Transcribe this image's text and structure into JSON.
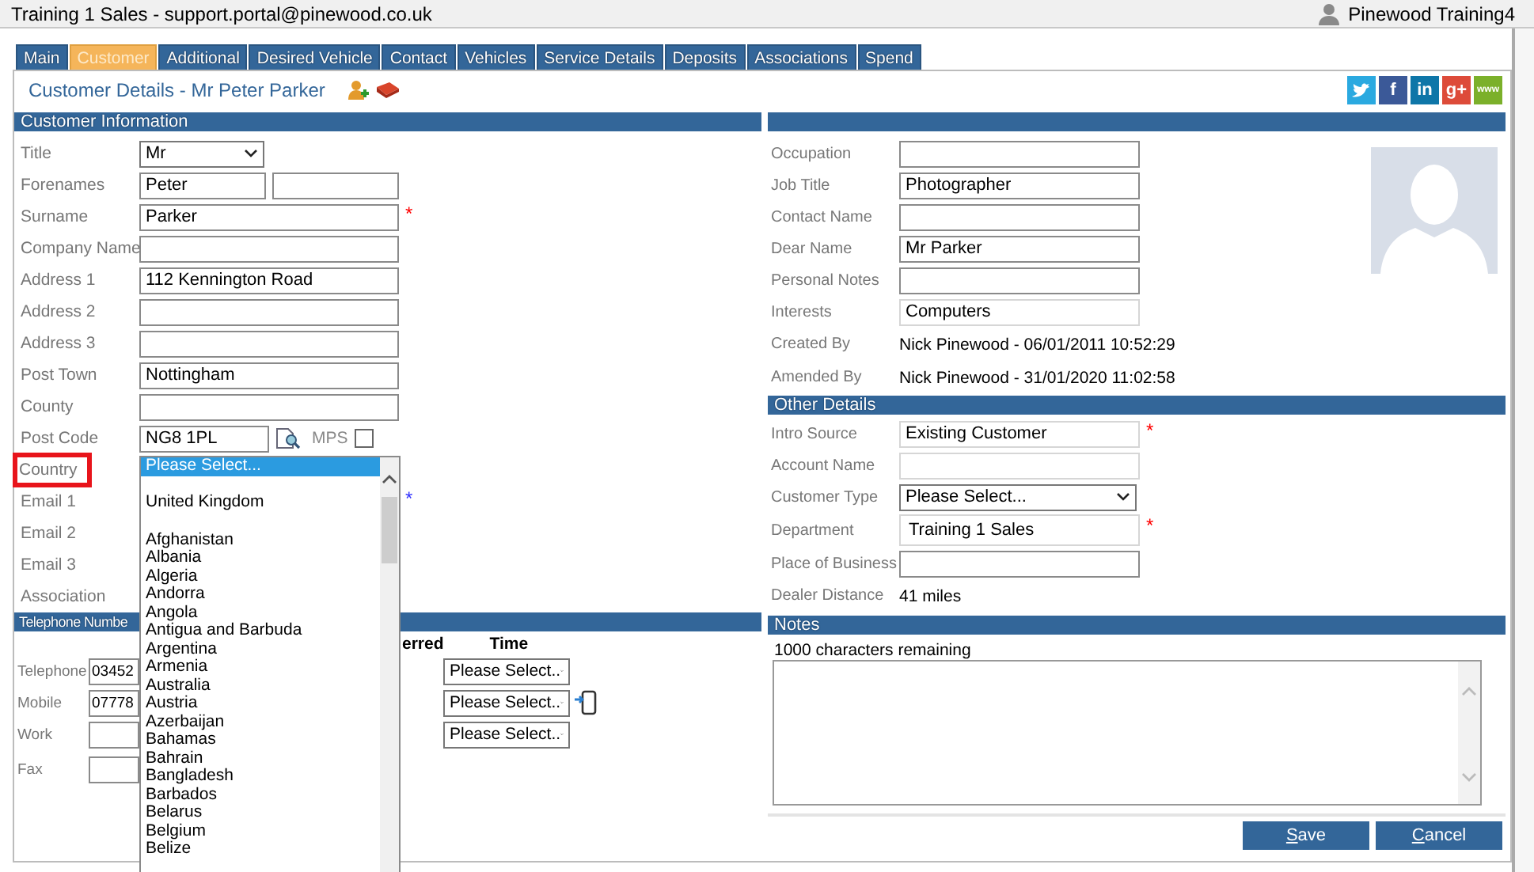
{
  "window": {
    "title": "Training 1 Sales - support.portal@pinewood.co.uk",
    "user": "Pinewood Training4"
  },
  "tabs": [
    {
      "label": "Main",
      "selected": false
    },
    {
      "label": "Customer",
      "selected": true
    },
    {
      "label": "Additional",
      "selected": false
    },
    {
      "label": "Desired Vehicle",
      "selected": false
    },
    {
      "label": "Contact",
      "selected": false
    },
    {
      "label": "Vehicles",
      "selected": false
    },
    {
      "label": "Service Details",
      "selected": false
    },
    {
      "label": "Deposits",
      "selected": false
    },
    {
      "label": "Associations",
      "selected": false
    },
    {
      "label": "Spend",
      "selected": false
    }
  ],
  "page_title": "Customer Details - Mr Peter Parker",
  "social_links": [
    {
      "kind": "twitter"
    },
    {
      "kind": "facebook",
      "glyph": "f"
    },
    {
      "kind": "linkedin",
      "glyph": "in"
    },
    {
      "kind": "google",
      "glyph": "g+"
    },
    {
      "kind": "web",
      "glyph": "www"
    }
  ],
  "customer_information": {
    "heading": "Customer Information",
    "fields": [
      {
        "label": "Title",
        "kind": "select",
        "value": "Mr",
        "highlighted": false
      },
      {
        "label": "Forenames",
        "kind": "pair",
        "value": "Peter",
        "highlighted": false
      },
      {
        "label": "Surname",
        "kind": "text",
        "value": "Parker",
        "required_mark": "*",
        "color": "#ff0000",
        "highlighted": false
      },
      {
        "label": "Company Name",
        "kind": "text",
        "highlighted": false
      },
      {
        "label": "Address 1",
        "kind": "text",
        "value": "112 Kennington Road",
        "highlighted": false
      },
      {
        "label": "Address 2",
        "kind": "text",
        "highlighted": false
      },
      {
        "label": "Address 3",
        "kind": "text",
        "highlighted": false
      },
      {
        "label": "Post Town",
        "kind": "text",
        "value": "Nottingham",
        "highlighted": false
      },
      {
        "label": "County",
        "kind": "text",
        "highlighted": false
      },
      {
        "label": "Post Code",
        "kind": "postcode",
        "value": "NG8 1PL",
        "mps_label": "MPS",
        "mps_checked": false,
        "highlighted": false
      },
      {
        "label": "Country",
        "kind": "covered",
        "highlighted": true
      },
      {
        "label": "Email 1",
        "kind": "covered",
        "required_mark": "*",
        "color": "#3333ff",
        "highlighted": false
      },
      {
        "label": "Email 2",
        "kind": "covered",
        "highlighted": false
      },
      {
        "label": "Email 3",
        "kind": "covered",
        "highlighted": false
      },
      {
        "label": "Association",
        "kind": "covered",
        "highlighted": false
      }
    ]
  },
  "telephone_numbers": {
    "heading": "Telephone Numbe",
    "columns": [
      "erred",
      "Time"
    ],
    "rows": [
      {
        "label": "Telephone",
        "value": "03452",
        "time": "Please Select..",
        "kind": "plain"
      },
      {
        "label": "Mobile",
        "value": "07778",
        "time": "Please Select..",
        "kind": "mobile"
      },
      {
        "label": "Work",
        "time": "Please Select..",
        "kind": "plain"
      },
      {
        "label": "Fax",
        "kind": "plain"
      }
    ]
  },
  "personal_details": {
    "fields": [
      {
        "label": "Occupation",
        "kind": "text"
      },
      {
        "label": "Job Title",
        "kind": "text",
        "value": "Photographer"
      },
      {
        "label": "Contact Name",
        "kind": "text"
      },
      {
        "label": "Dear Name",
        "kind": "text",
        "value": "Mr Parker"
      },
      {
        "label": "Personal Notes",
        "kind": "text"
      },
      {
        "label": "Interests",
        "kind": "light",
        "value": "Computers"
      },
      {
        "label": "Created By",
        "kind": "static",
        "value": "Nick Pinewood - 06/01/2011 10:52:29"
      },
      {
        "label": "Amended By",
        "kind": "static",
        "value": "Nick Pinewood - 31/01/2020 11:02:58"
      }
    ]
  },
  "other_details": {
    "heading": "Other Details",
    "fields": [
      {
        "label": "Intro Source",
        "kind": "light",
        "value": "Existing Customer",
        "required_mark": "*",
        "color": "#ff0000"
      },
      {
        "label": "Account Name",
        "kind": "light"
      },
      {
        "label": "Customer Type",
        "kind": "select",
        "value": "Please Select..."
      },
      {
        "label": "Department",
        "kind": "tall",
        "value": "Training 1 Sales",
        "required_mark": "*",
        "color": "#ff0000"
      },
      {
        "label": "Place of Business",
        "kind": "text"
      },
      {
        "label": "Dealer Distance",
        "kind": "static",
        "value": "41 miles"
      }
    ]
  },
  "notes": {
    "heading": "Notes",
    "counter": "1000 characters remaining"
  },
  "buttons": [
    {
      "label": "Save"
    },
    {
      "label": "Cancel"
    }
  ],
  "country_list": {
    "options": [
      {
        "label": "Please Select...",
        "kind": "option",
        "selected": true
      },
      {
        "label": "United Kingdom",
        "kind": "spaced",
        "selected": false
      },
      {
        "label": "Afghanistan",
        "kind": "option",
        "selected": false
      },
      {
        "label": "Albania",
        "kind": "option",
        "selected": false
      },
      {
        "label": "Algeria",
        "kind": "option",
        "selected": false
      },
      {
        "label": "Andorra",
        "kind": "option",
        "selected": false
      },
      {
        "label": "Angola",
        "kind": "option",
        "selected": false
      },
      {
        "label": "Antigua and Barbuda",
        "kind": "option",
        "selected": false
      },
      {
        "label": "Argentina",
        "kind": "option",
        "selected": false
      },
      {
        "label": "Armenia",
        "kind": "option",
        "selected": false
      },
      {
        "label": "Australia",
        "kind": "option",
        "selected": false
      },
      {
        "label": "Austria",
        "kind": "option",
        "selected": false
      },
      {
        "label": "Azerbaijan",
        "kind": "option",
        "selected": false
      },
      {
        "label": "Bahamas",
        "kind": "option",
        "selected": false
      },
      {
        "label": "Bahrain",
        "kind": "option",
        "selected": false
      },
      {
        "label": "Bangladesh",
        "kind": "option",
        "selected": false
      },
      {
        "label": "Barbados",
        "kind": "option",
        "selected": false
      },
      {
        "label": "Belarus",
        "kind": "option",
        "selected": false
      },
      {
        "label": "Belgium",
        "kind": "option",
        "selected": false
      },
      {
        "label": "Belize",
        "kind": "option",
        "selected": false
      }
    ]
  }
}
